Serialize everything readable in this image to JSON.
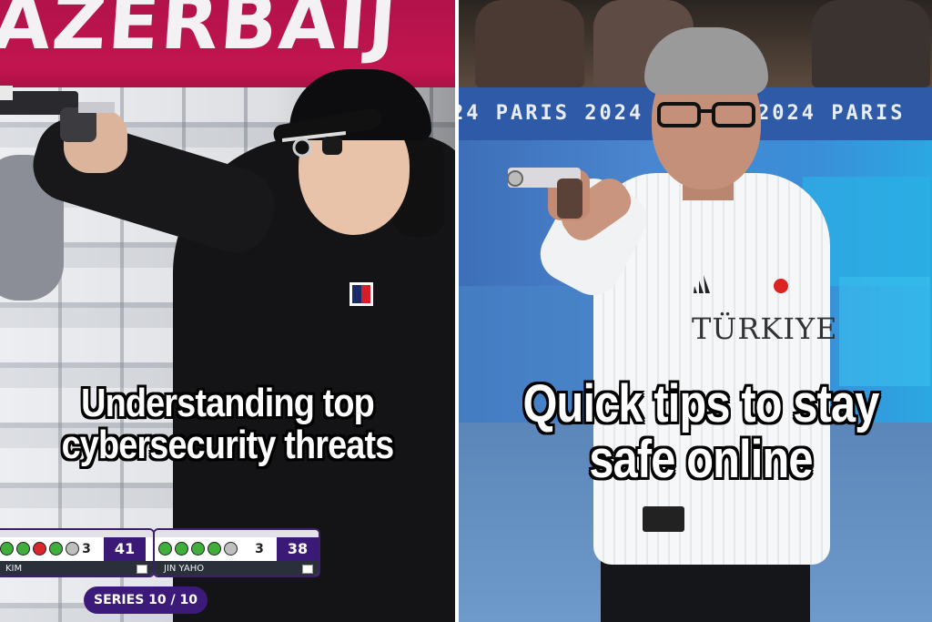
{
  "left_panel": {
    "banner_text": "AZERBAIJ",
    "caption_line1": "Understanding top",
    "caption_line2": "cybersecurity threats",
    "scoreboard": {
      "player1": {
        "shots": [
          "green",
          "green",
          "red",
          "green",
          "target"
        ],
        "series": "3",
        "total": "41",
        "name": "KIM"
      },
      "player2": {
        "shots": [
          "green",
          "green",
          "green",
          "green",
          "target"
        ],
        "series": "3",
        "total": "38",
        "name": "JIN YAHO"
      },
      "series_label": "SERIES",
      "series_value": "10 / 10"
    }
  },
  "right_panel": {
    "venue_text_left": "24  PARIS 2024",
    "venue_text_right": "2024   PARIS",
    "shirt_text": "TÜRKIYE",
    "caption_line1": "Quick tips to stay",
    "caption_line2": "safe online"
  },
  "colors": {
    "caption_text": "#ffffff",
    "caption_outline": "#000000",
    "banner": "#c2154f",
    "score_total_bg": "#3a1a76",
    "wall_blue": "#3d6fb8"
  }
}
